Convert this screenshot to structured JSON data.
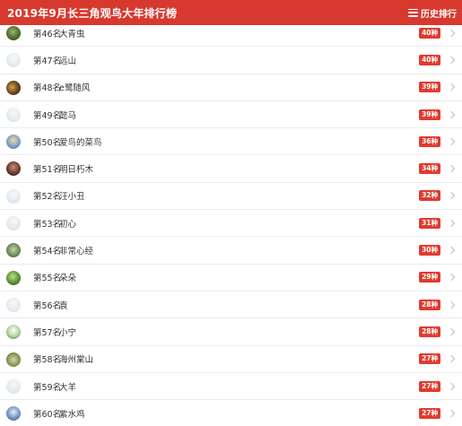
{
  "header": {
    "title": "2019年9月长三角观鸟大年排行榜",
    "history_label": "历史排行",
    "accent_color": "#d8392f"
  },
  "rows": [
    {
      "rank": "第46名",
      "name": "大青虫",
      "count": "40种",
      "avatar": "photo1"
    },
    {
      "rank": "第47名",
      "name": "远山",
      "count": "40种",
      "avatar": "default"
    },
    {
      "rank": "第48名",
      "name": "e鹭随风",
      "count": "39种",
      "avatar": "photo2"
    },
    {
      "rank": "第49名",
      "name": "懿马",
      "count": "39种",
      "avatar": "default"
    },
    {
      "rank": "第50名",
      "name": "爱鸟的菜鸟",
      "count": "36种",
      "avatar": "photo3"
    },
    {
      "rank": "第51名",
      "name": "明日朽木",
      "count": "34种",
      "avatar": "photo4"
    },
    {
      "rank": "第52名",
      "name": "汪小丑",
      "count": "32种",
      "avatar": "default"
    },
    {
      "rank": "第53名",
      "name": "初心",
      "count": "31种",
      "avatar": "default"
    },
    {
      "rank": "第54名",
      "name": "非常心经",
      "count": "30种",
      "avatar": "photo5"
    },
    {
      "rank": "第55名",
      "name": "朵朵",
      "count": "29种",
      "avatar": "photo6"
    },
    {
      "rank": "第56名",
      "name": "袁",
      "count": "28种",
      "avatar": "default"
    },
    {
      "rank": "第57名",
      "name": "小宁",
      "count": "28种",
      "avatar": "photo7"
    },
    {
      "rank": "第58名",
      "name": "海州棠山",
      "count": "27种",
      "avatar": "photo8"
    },
    {
      "rank": "第59名",
      "name": "大羊",
      "count": "27种",
      "avatar": "default"
    },
    {
      "rank": "第60名",
      "name": "紫水鸡",
      "count": "27种",
      "avatar": "photo9"
    }
  ]
}
